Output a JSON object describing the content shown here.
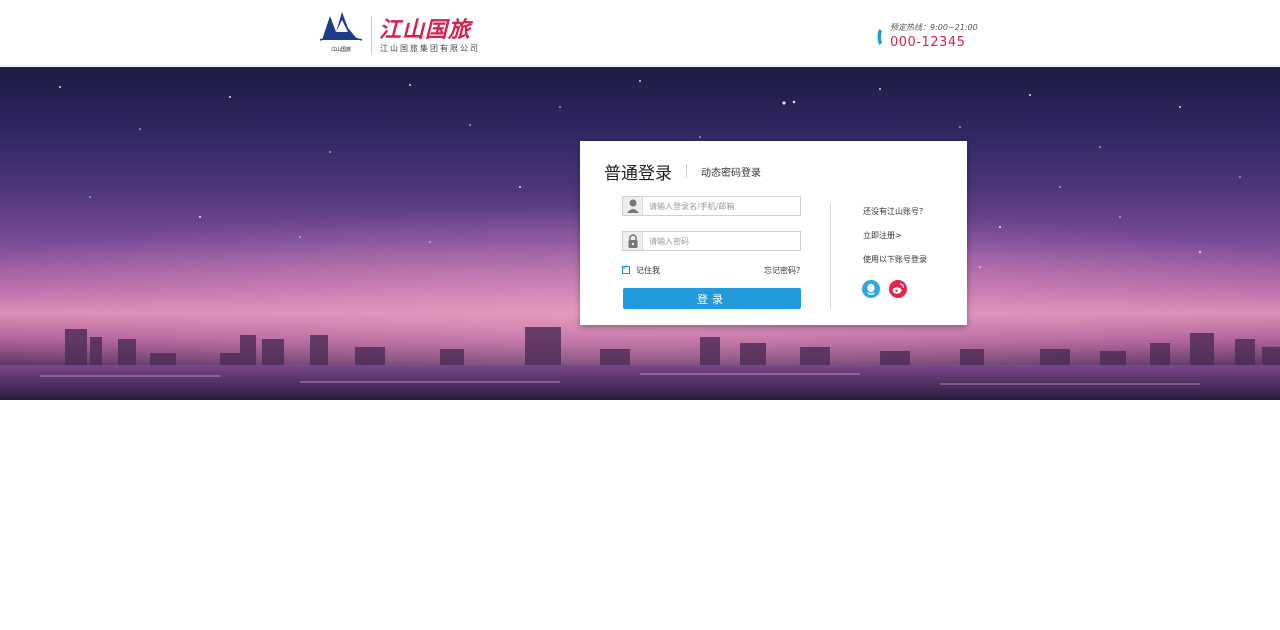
{
  "header": {
    "logo_mark_text": "江山国旅",
    "brand_name": "江山国旅",
    "brand_subtitle": "江山国旅集团有限公司",
    "hotline_label": "预定热线：9:00~21:00",
    "hotline_number": "000-12345"
  },
  "login": {
    "tab_normal": "普通登录",
    "tab_dynamic": "动态密码登录",
    "username_placeholder": "请输入登录名/手机/邮箱",
    "password_placeholder": "请输入密码",
    "remember_label": "记住我",
    "remember_checked": true,
    "forgot_label": "忘记密码？",
    "submit_label": "登录"
  },
  "side": {
    "no_account": "还没有江山账号？",
    "register_link": "立即注册>",
    "other_login": "使用以下账号登录",
    "social": [
      "qq-icon",
      "weibo-icon"
    ]
  },
  "colors": {
    "brand": "#d6224d",
    "primary": "#229bdc"
  }
}
